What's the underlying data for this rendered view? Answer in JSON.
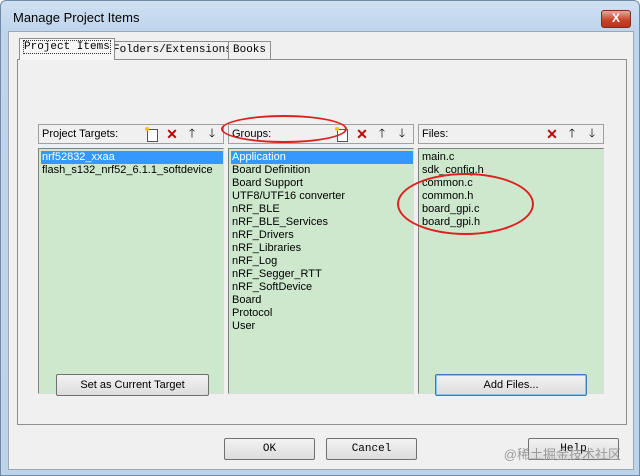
{
  "window": {
    "title": "Manage Project Items",
    "close_glyph": "X"
  },
  "tabs": [
    "Project Items",
    "Folders/Extensions",
    "Books"
  ],
  "targets": {
    "label": "Project Targets:",
    "items": [
      "nrf52832_xxaa",
      "flash_s132_nrf52_6.1.1_softdevice"
    ],
    "selected": 0
  },
  "groups": {
    "label": "Groups:",
    "items": [
      "Application",
      "Board Definition",
      "Board Support",
      "UTF8/UTF16 converter",
      "nRF_BLE",
      "nRF_BLE_Services",
      "nRF_Drivers",
      "nRF_Libraries",
      "nRF_Log",
      "nRF_Segger_RTT",
      "nRF_SoftDevice",
      "Board",
      "Protocol",
      "User"
    ],
    "selected": 0
  },
  "files": {
    "label": "Files:",
    "items": [
      "main.c",
      "sdk_config.h",
      "common.c",
      "common.h",
      "board_gpi.c",
      "board_gpi.h"
    ]
  },
  "buttons": {
    "set_current": "Set as Current Target",
    "add_files": "Add Files...",
    "ok": "OK",
    "cancel": "Cancel",
    "help": "Help"
  },
  "watermark": "@稀土掘金技术社区",
  "icons": [
    "new-icon",
    "delete-icon",
    "move-up-icon",
    "move-down-icon"
  ],
  "colors": {
    "list_bg": "#cde8cd",
    "selection": "#3399ff",
    "annotation": "#e02020"
  }
}
